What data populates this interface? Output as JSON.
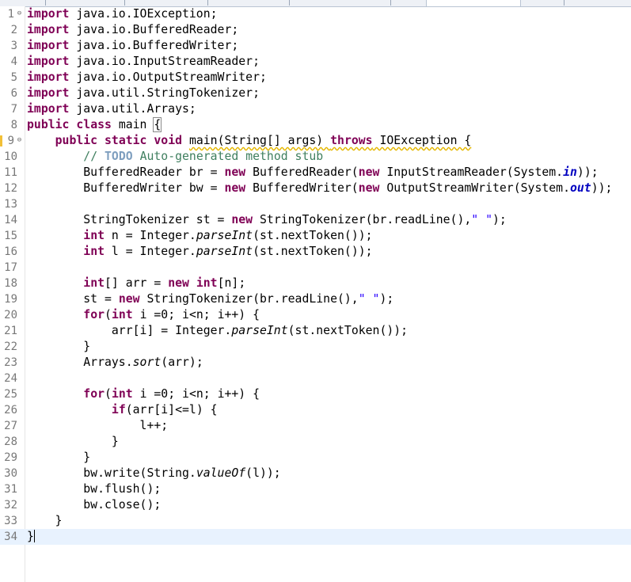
{
  "editor": {
    "lines": [
      {
        "n": "1",
        "fold": "⊖",
        "tokens": [
          {
            "t": "import",
            "c": "kw"
          },
          {
            "t": " java.io.IOException;"
          }
        ]
      },
      {
        "n": "2",
        "tokens": [
          {
            "t": "import",
            "c": "kw"
          },
          {
            "t": " java.io.BufferedReader;"
          }
        ]
      },
      {
        "n": "3",
        "tokens": [
          {
            "t": "import",
            "c": "kw"
          },
          {
            "t": " java.io.BufferedWriter;"
          }
        ]
      },
      {
        "n": "4",
        "tokens": [
          {
            "t": "import",
            "c": "kw"
          },
          {
            "t": " java.io.InputStreamReader;"
          }
        ]
      },
      {
        "n": "5",
        "tokens": [
          {
            "t": "import",
            "c": "kw"
          },
          {
            "t": " java.io.OutputStreamWriter;"
          }
        ]
      },
      {
        "n": "6",
        "tokens": [
          {
            "t": "import",
            "c": "kw"
          },
          {
            "t": " java.util.StringTokenizer;"
          }
        ]
      },
      {
        "n": "7",
        "tokens": [
          {
            "t": "import",
            "c": "kw"
          },
          {
            "t": " java.util.Arrays;"
          }
        ]
      },
      {
        "n": "8",
        "tokens": [
          {
            "t": "public",
            "c": "kw"
          },
          {
            "t": " "
          },
          {
            "t": "class",
            "c": "kw"
          },
          {
            "t": " main "
          },
          {
            "t": "{",
            "c": "brk"
          }
        ]
      },
      {
        "n": "9",
        "fold": "⊖",
        "warn": true,
        "tokens": [
          {
            "t": "    "
          },
          {
            "t": "public",
            "c": "kw"
          },
          {
            "t": " "
          },
          {
            "t": "static",
            "c": "kw"
          },
          {
            "t": " "
          },
          {
            "t": "void",
            "c": "kw"
          },
          {
            "t": " "
          },
          {
            "t": "main(String[] args) ",
            "c": "wavy"
          },
          {
            "t": "throws",
            "c": "kw wavy"
          },
          {
            "t": " IOException {",
            "c": "wavy"
          }
        ]
      },
      {
        "n": "10",
        "tokens": [
          {
            "t": "        "
          },
          {
            "t": "// ",
            "c": "cm"
          },
          {
            "t": "TODO",
            "c": "todo"
          },
          {
            "t": " Auto-generated method stub",
            "c": "cm"
          }
        ]
      },
      {
        "n": "11",
        "tokens": [
          {
            "t": "        BufferedReader br = "
          },
          {
            "t": "new",
            "c": "kw"
          },
          {
            "t": " BufferedReader("
          },
          {
            "t": "new",
            "c": "kw"
          },
          {
            "t": " InputStreamReader(System."
          },
          {
            "t": "in",
            "c": "sf"
          },
          {
            "t": "));"
          }
        ]
      },
      {
        "n": "12",
        "tokens": [
          {
            "t": "        BufferedWriter bw = "
          },
          {
            "t": "new",
            "c": "kw"
          },
          {
            "t": " BufferedWriter("
          },
          {
            "t": "new",
            "c": "kw"
          },
          {
            "t": " OutputStreamWriter(System."
          },
          {
            "t": "out",
            "c": "sf"
          },
          {
            "t": "));"
          }
        ]
      },
      {
        "n": "13",
        "tokens": []
      },
      {
        "n": "14",
        "tokens": [
          {
            "t": "        StringTokenizer st = "
          },
          {
            "t": "new",
            "c": "kw"
          },
          {
            "t": " StringTokenizer(br.readLine(),"
          },
          {
            "t": "\" \"",
            "c": "st"
          },
          {
            "t": ");"
          }
        ]
      },
      {
        "n": "15",
        "tokens": [
          {
            "t": "        "
          },
          {
            "t": "int",
            "c": "kw"
          },
          {
            "t": " n = Integer."
          },
          {
            "t": "parseInt",
            "c": "sm"
          },
          {
            "t": "(st.nextToken());"
          }
        ]
      },
      {
        "n": "16",
        "tokens": [
          {
            "t": "        "
          },
          {
            "t": "int",
            "c": "kw"
          },
          {
            "t": " l = Integer."
          },
          {
            "t": "parseInt",
            "c": "sm"
          },
          {
            "t": "(st.nextToken());"
          }
        ]
      },
      {
        "n": "17",
        "tokens": []
      },
      {
        "n": "18",
        "tokens": [
          {
            "t": "        "
          },
          {
            "t": "int",
            "c": "kw"
          },
          {
            "t": "[] arr = "
          },
          {
            "t": "new",
            "c": "kw"
          },
          {
            "t": " "
          },
          {
            "t": "int",
            "c": "kw"
          },
          {
            "t": "[n];"
          }
        ]
      },
      {
        "n": "19",
        "tokens": [
          {
            "t": "        st = "
          },
          {
            "t": "new",
            "c": "kw"
          },
          {
            "t": " StringTokenizer(br.readLine(),"
          },
          {
            "t": "\" \"",
            "c": "st"
          },
          {
            "t": ");"
          }
        ]
      },
      {
        "n": "20",
        "tokens": [
          {
            "t": "        "
          },
          {
            "t": "for",
            "c": "kw"
          },
          {
            "t": "("
          },
          {
            "t": "int",
            "c": "kw"
          },
          {
            "t": " i =0; i<n; i++) {"
          }
        ]
      },
      {
        "n": "21",
        "tokens": [
          {
            "t": "            arr[i] = Integer."
          },
          {
            "t": "parseInt",
            "c": "sm"
          },
          {
            "t": "(st.nextToken());"
          }
        ]
      },
      {
        "n": "22",
        "tokens": [
          {
            "t": "        }"
          }
        ]
      },
      {
        "n": "23",
        "tokens": [
          {
            "t": "        Arrays."
          },
          {
            "t": "sort",
            "c": "sm"
          },
          {
            "t": "(arr);"
          }
        ]
      },
      {
        "n": "24",
        "tokens": []
      },
      {
        "n": "25",
        "tokens": [
          {
            "t": "        "
          },
          {
            "t": "for",
            "c": "kw"
          },
          {
            "t": "("
          },
          {
            "t": "int",
            "c": "kw"
          },
          {
            "t": " i =0; i<n; i++) {"
          }
        ]
      },
      {
        "n": "26",
        "tokens": [
          {
            "t": "            "
          },
          {
            "t": "if",
            "c": "kw"
          },
          {
            "t": "(arr[i]<=l) {"
          }
        ]
      },
      {
        "n": "27",
        "tokens": [
          {
            "t": "                l++;"
          }
        ]
      },
      {
        "n": "28",
        "tokens": [
          {
            "t": "            }"
          }
        ]
      },
      {
        "n": "29",
        "tokens": [
          {
            "t": "        }"
          }
        ]
      },
      {
        "n": "30",
        "tokens": [
          {
            "t": "        bw.write(String."
          },
          {
            "t": "valueOf",
            "c": "sm"
          },
          {
            "t": "(l));"
          }
        ]
      },
      {
        "n": "31",
        "tokens": [
          {
            "t": "        bw.flush();"
          }
        ]
      },
      {
        "n": "32",
        "tokens": [
          {
            "t": "        bw.close();"
          }
        ]
      },
      {
        "n": "33",
        "tokens": [
          {
            "t": "    }"
          }
        ]
      },
      {
        "n": "34",
        "current": true,
        "caret": true,
        "tokens": [
          {
            "t": "}"
          }
        ]
      }
    ]
  },
  "colors": {
    "keyword": "#7f0055",
    "comment": "#3f7f5f",
    "todo": "#7f9fbf",
    "string": "#2a00ff",
    "static_field": "#0000c0",
    "line_number": "#787878",
    "current_line": "#e8f2fe",
    "warning": "#f2c037"
  }
}
